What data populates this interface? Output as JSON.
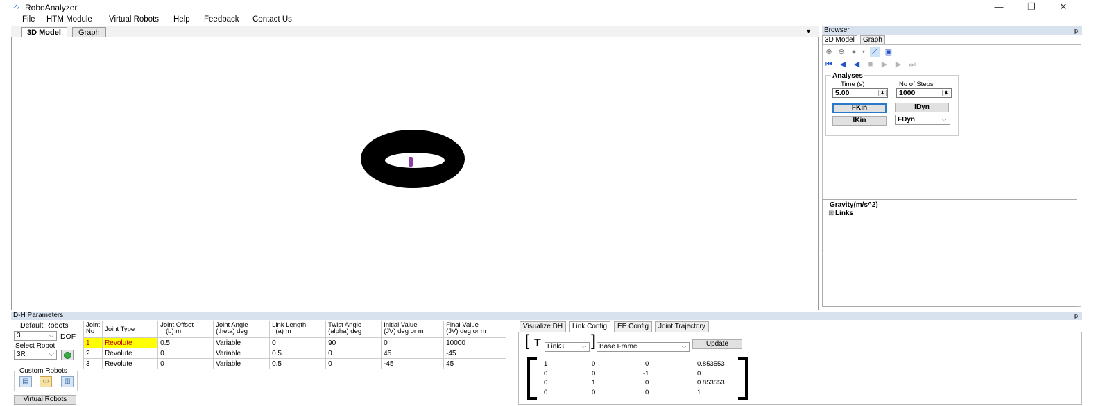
{
  "window": {
    "title": "RoboAnalyzer",
    "controls": {
      "minimize": "—",
      "restore": "❐",
      "close": "✕"
    }
  },
  "menu": [
    "File",
    "HTM Module",
    "Virtual Robots",
    "Help",
    "Feedback",
    "Contact Us"
  ],
  "main_tabs": {
    "model": "3D Model",
    "graph": "Graph",
    "dropdown": "▼"
  },
  "browser": {
    "title": "Browser",
    "pin": "ᵽ",
    "tabs": {
      "model": "3D Model",
      "graph": "Graph"
    },
    "toolbar_icons": [
      "zoom-in-icon",
      "zoom-out-icon",
      "sphere-icon",
      "dropdown-arrow-icon",
      "axes-icon",
      "image-icon"
    ],
    "playback_icons": [
      "first-frame-icon",
      "step-back-icon",
      "play-backward-icon",
      "stop-icon",
      "step-forward-icon",
      "play-icon",
      "last-frame-icon"
    ],
    "analyses": {
      "title": "Analyses",
      "time_label": "Time (s)",
      "time_value": "5.00",
      "steps_label": "No of Steps",
      "steps_value": "1000",
      "fkin": "FKin",
      "idyn": "IDyn",
      "ikin": "IKin",
      "fdyn": "FDyn"
    },
    "tree": {
      "gravity": "Gravity(m/s^2)",
      "links": "Links",
      "expand": "⊞"
    }
  },
  "dh": {
    "title": "D-H Parameters",
    "pin": "ᵽ",
    "default_robots_label": "Default Robots",
    "dof_value": "3",
    "dof_label": "DOF",
    "select_robot_label": "Select Robot",
    "robot_value": "3R",
    "custom_robots_label": "Custom Robots",
    "virtual_robots_button": "Virtual Robots",
    "columns": [
      [
        "Joint",
        "No"
      ],
      [
        "Joint Type",
        ""
      ],
      [
        "Joint Offset",
        "(b) m"
      ],
      [
        "Joint Angle",
        "(theta) deg"
      ],
      [
        "Link Length",
        "(a) m"
      ],
      [
        "Twist Angle",
        "(alpha) deg"
      ],
      [
        "Initial Value",
        "(JV)  deg or m"
      ],
      [
        "Final Value",
        "(JV)  deg or m"
      ]
    ],
    "rows": [
      [
        "1",
        "Revolute",
        "0.5",
        "Variable",
        "0",
        "90",
        "0",
        "10000"
      ],
      [
        "2",
        "Revolute",
        "0",
        "Variable",
        "0.5",
        "0",
        "45",
        "-45"
      ],
      [
        "3",
        "Revolute",
        "0",
        "Variable",
        "0.5",
        "0",
        "-45",
        "45"
      ]
    ]
  },
  "link_config": {
    "tabs": [
      "Visualize DH",
      "Link Config",
      "EE Config",
      "Joint Trajectory"
    ],
    "active_tab": "Link Config",
    "T": "T",
    "link_select": "Link3",
    "frame_select": "Base Frame",
    "update": "Update",
    "matrix": [
      [
        "1",
        "0",
        "0",
        "0.853553"
      ],
      [
        "0",
        "0",
        "-1",
        "0"
      ],
      [
        "0",
        "1",
        "0",
        "0.853553"
      ],
      [
        "0",
        "0",
        "0",
        "1"
      ]
    ]
  }
}
